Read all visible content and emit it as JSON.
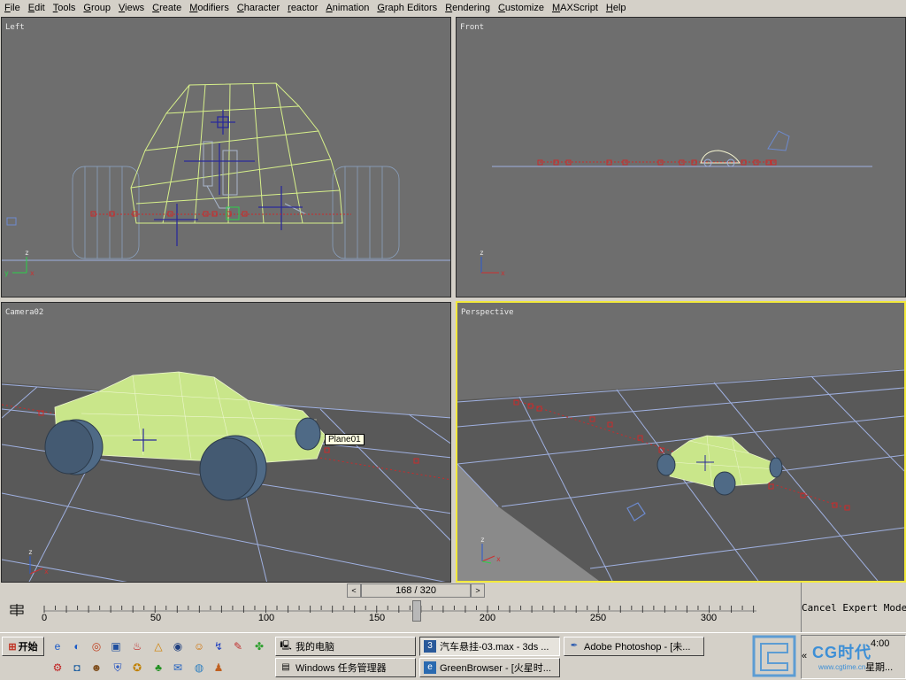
{
  "menubar": {
    "items": [
      "File",
      "Edit",
      "Tools",
      "Group",
      "Views",
      "Create",
      "Modifiers",
      "Character",
      "reactor",
      "Animation",
      "Graph Editors",
      "Rendering",
      "Customize",
      "MAXScript",
      "Help"
    ]
  },
  "viewports": {
    "left": {
      "label": "Left"
    },
    "front": {
      "label": "Front"
    },
    "camera": {
      "label": "Camera02",
      "tooltip": "Plane01"
    },
    "perspective": {
      "label": "Perspective",
      "active": true
    }
  },
  "timeslider": {
    "frame_text": "168 / 320",
    "prev_glyph": "<",
    "next_glyph": ">",
    "current_frame": 168,
    "total_frames": 320
  },
  "trackbar": {
    "tick_labels": [
      "0",
      "50",
      "100",
      "150",
      "200",
      "250",
      "300"
    ],
    "icon": "key-filter-icon"
  },
  "status": {
    "expert_text": "Cancel Expert Mode"
  },
  "taskbar": {
    "start_label": "开始",
    "tasks": [
      {
        "label": "我的电脑",
        "icon": "computer-icon"
      },
      {
        "label": "汽车悬挂-03.max - 3ds ...",
        "icon": "3dsmax-icon"
      },
      {
        "label": "Adobe Photoshop - [未...",
        "icon": "photoshop-icon"
      },
      {
        "label": "Windows 任务管理器",
        "icon": "task-manager-icon"
      },
      {
        "label": "GreenBrowser - [火星时...",
        "icon": "browser-icon"
      }
    ],
    "tray_arrow": "«",
    "clock": "4:00",
    "weekday": "星期...",
    "watermark_text": "CG时代",
    "watermark_url": "www.cgtime.cn"
  },
  "colors": {
    "viewport_bg": "#6e6e6e",
    "grid": "#9fb0e0",
    "wire": "#d7f08a",
    "car_fill": "#c9e68a",
    "wheel": "#4f6a86",
    "path": "#cc2a2a",
    "active_border": "#f2e93c"
  }
}
